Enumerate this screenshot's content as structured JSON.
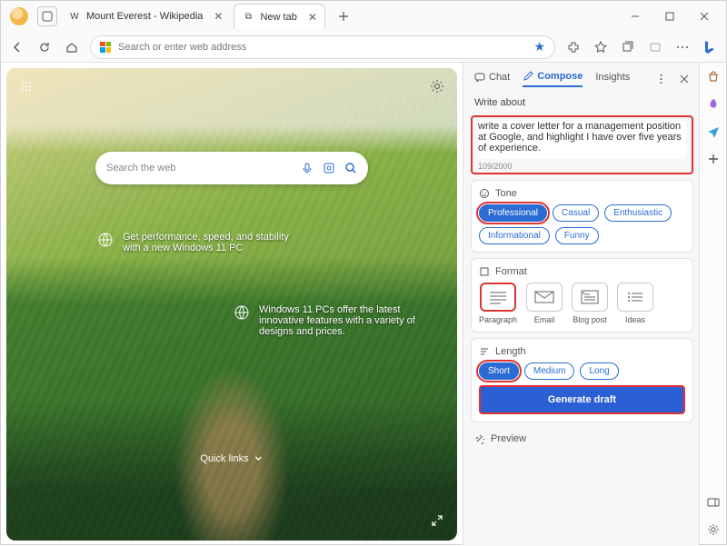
{
  "window": {
    "title": "Mount Everest - Wikipedia"
  },
  "tabs": [
    {
      "label": "Mount Everest - Wikipedia",
      "favicon": "W"
    },
    {
      "label": "New tab",
      "favicon": "⧉"
    }
  ],
  "addressbar": {
    "placeholder": "Search or enter web address"
  },
  "ntp": {
    "search_placeholder": "Search the web",
    "promo1": "Get performance, speed, and stability with a new Windows 11 PC",
    "promo2": "Windows 11 PCs offer the latest innovative features with a variety of designs and prices.",
    "quick_links": "Quick links"
  },
  "sidebar": {
    "tabs": {
      "chat": "Chat",
      "compose": "Compose",
      "insights": "Insights"
    },
    "write_about": {
      "label": "Write about",
      "text": "write a cover letter for a management position at Google, and highlight I have over five years of experience.",
      "count": "109/2000"
    },
    "tone": {
      "label": "Tone",
      "options": [
        "Professional",
        "Casual",
        "Enthusiastic",
        "Informational",
        "Funny"
      ],
      "selected": "Professional"
    },
    "format": {
      "label": "Format",
      "options": [
        "Paragraph",
        "Email",
        "Blog post",
        "Ideas"
      ],
      "selected": "Paragraph"
    },
    "length": {
      "label": "Length",
      "options": [
        "Short",
        "Medium",
        "Long"
      ],
      "selected": "Short"
    },
    "generate": "Generate draft",
    "preview": "Preview"
  }
}
